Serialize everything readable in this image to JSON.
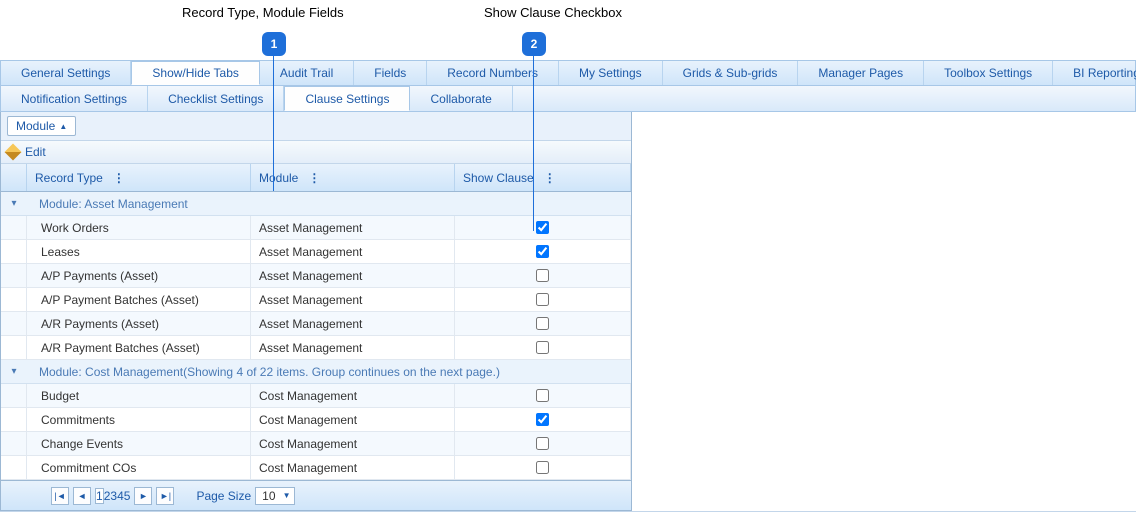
{
  "callouts": {
    "c1": {
      "label": "Record Type, Module Fields",
      "num": "1"
    },
    "c2": {
      "label": "Show Clause Checkbox",
      "num": "2"
    }
  },
  "tabs_main": [
    "General Settings",
    "Show/Hide Tabs",
    "Audit Trail",
    "Fields",
    "Record Numbers",
    "My Settings",
    "Grids & Sub-grids",
    "Manager Pages",
    "Toolbox Settings",
    "BI Reporting"
  ],
  "tabs_main_active": 1,
  "tabs_sub": [
    "Notification Settings",
    "Checklist Settings",
    "Clause Settings",
    "Collaborate"
  ],
  "tabs_sub_active": 2,
  "group_chip": "Module",
  "toolbar_edit": "Edit",
  "columns": {
    "record_type": "Record Type",
    "module": "Module",
    "show_clause": "Show Clause"
  },
  "groups": [
    {
      "title": "Module: Asset Management",
      "rows": [
        {
          "rt": "Work Orders",
          "mod": "Asset Management",
          "show": true
        },
        {
          "rt": "Leases",
          "mod": "Asset Management",
          "show": true
        },
        {
          "rt": "A/P Payments (Asset)",
          "mod": "Asset Management",
          "show": false
        },
        {
          "rt": "A/P Payment Batches (Asset)",
          "mod": "Asset Management",
          "show": false
        },
        {
          "rt": "A/R Payments (Asset)",
          "mod": "Asset Management",
          "show": false
        },
        {
          "rt": "A/R Payment Batches (Asset)",
          "mod": "Asset Management",
          "show": false
        }
      ]
    },
    {
      "title": "Module: Cost Management(Showing 4 of 22 items. Group continues on the next page.)",
      "rows": [
        {
          "rt": "Budget",
          "mod": "Cost Management",
          "show": false
        },
        {
          "rt": "Commitments",
          "mod": "Cost Management",
          "show": true
        },
        {
          "rt": "Change Events",
          "mod": "Cost Management",
          "show": false
        },
        {
          "rt": "Commitment COs",
          "mod": "Cost Management",
          "show": false
        }
      ]
    }
  ],
  "pager": {
    "pages": [
      "1",
      "2",
      "3",
      "4",
      "5"
    ],
    "current": "1",
    "page_size_label": "Page Size",
    "page_size_value": "10"
  }
}
